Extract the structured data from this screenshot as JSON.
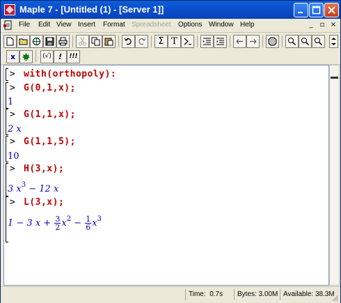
{
  "window": {
    "title": "Maple 7 - [Untitled (1) - [Server 1]]"
  },
  "menu": {
    "items": [
      "File",
      "Edit",
      "View",
      "Insert",
      "Format",
      "Spreadsheet",
      "Options",
      "Window",
      "Help"
    ],
    "disabled": [
      "Spreadsheet"
    ]
  },
  "toolbar2": {
    "labels": [
      "x",
      "",
      "(√)",
      "!",
      "!!!"
    ]
  },
  "worksheet": {
    "prompt": ">",
    "inputs": [
      "with(orthopoly):",
      "G(0,1,x);",
      "G(1,1,x);",
      "G(1,1,5);",
      "H(3,x);",
      "L(3,x);"
    ],
    "outputs": [
      "1",
      "2 x",
      "10",
      "3 x",
      "3",
      "− 12 x",
      "1 − 3 x +",
      "3",
      "2",
      "x",
      "2",
      "−",
      "1",
      "6",
      "x",
      "3"
    ]
  },
  "status": {
    "time_label": "Time:",
    "time_value": "0.7s",
    "bytes": "Bytes: 3.00M",
    "available": "Available: 38.3M"
  },
  "colors": {
    "input": "#c00000",
    "output": "#0000c0",
    "titlebar": "#0b4fcf"
  }
}
